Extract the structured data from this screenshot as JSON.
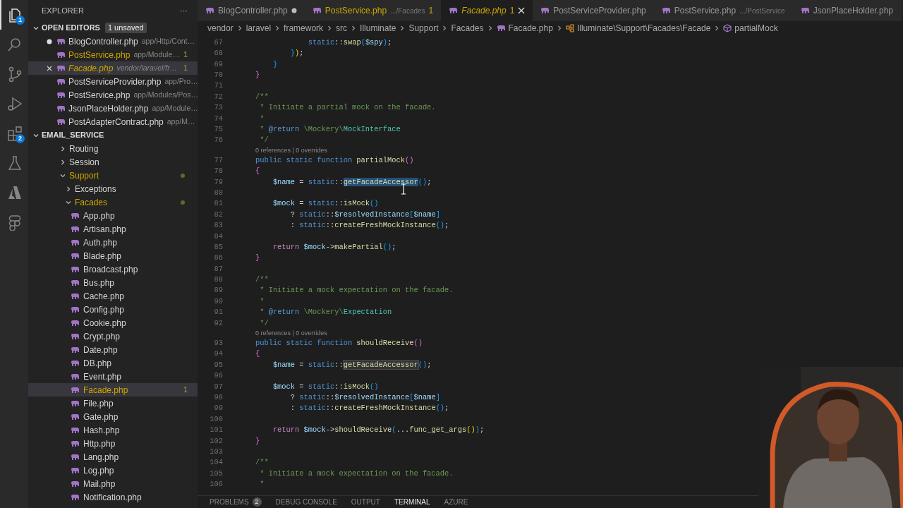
{
  "activity_bar": [
    {
      "kind": "files",
      "selected": true,
      "badge": "1"
    },
    {
      "kind": "search",
      "selected": false
    },
    {
      "kind": "source_control",
      "selected": false
    },
    {
      "kind": "run",
      "selected": false
    },
    {
      "kind": "extensions",
      "selected": false,
      "badge": "2"
    },
    {
      "kind": "testing",
      "selected": false
    },
    {
      "kind": "azure",
      "selected": false
    },
    {
      "kind": "figma",
      "selected": false
    }
  ],
  "sidebar": {
    "title": "EXPLORER",
    "more": "···",
    "open_editors": {
      "title": "OPEN EDITORS",
      "badge": "1 unsaved",
      "expanded": true,
      "items": [
        {
          "name": "BlogController.php",
          "path": "app/Http/Cont…",
          "dirty": true,
          "selected": false,
          "warning": false,
          "preview": false
        },
        {
          "name": "PostService.php",
          "path": "app/Module…",
          "count": "1",
          "dirty": false,
          "selected": false,
          "warning": true,
          "preview": false
        },
        {
          "name": "Facade.php",
          "path": "vendor/laravel/fr…",
          "count": "1",
          "dirty": false,
          "selected": true,
          "warning": true,
          "preview": true
        },
        {
          "name": "PostServiceProvider.php",
          "path": "app/Pro…",
          "dirty": false,
          "selected": false,
          "warning": false,
          "preview": false
        },
        {
          "name": "PostService.php",
          "path": "app/Modules/Pos…",
          "dirty": false,
          "selected": false,
          "warning": false,
          "preview": false
        },
        {
          "name": "JsonPlaceHolder.php",
          "path": "app/Module…",
          "dirty": false,
          "selected": false,
          "warning": false,
          "preview": false
        },
        {
          "name": "PostAdapterContract.php",
          "path": "app/M…",
          "dirty": false,
          "selected": false,
          "warning": false,
          "preview": false
        }
      ]
    },
    "project": {
      "title": "EMAIL_SERVICE",
      "expanded": true,
      "tree": [
        {
          "name": "Routing",
          "kind": "folder",
          "expanded": false,
          "selected": false,
          "warning": false
        },
        {
          "name": "Session",
          "kind": "folder",
          "expanded": false,
          "selected": false,
          "warning": false
        },
        {
          "name": "Support",
          "kind": "folder",
          "expanded": true,
          "selected": false,
          "warning": true,
          "children": [
            {
              "name": "Exceptions",
              "kind": "folder",
              "expanded": false,
              "selected": false,
              "warning": false
            },
            {
              "name": "Facades",
              "kind": "folder",
              "expanded": true,
              "selected": false,
              "warning": true,
              "children": [
                {
                  "name": "App.php",
                  "kind": "file",
                  "selected": false,
                  "warning": false
                },
                {
                  "name": "Artisan.php",
                  "kind": "file",
                  "selected": false,
                  "warning": false
                },
                {
                  "name": "Auth.php",
                  "kind": "file",
                  "selected": false,
                  "warning": false
                },
                {
                  "name": "Blade.php",
                  "kind": "file",
                  "selected": false,
                  "warning": false
                },
                {
                  "name": "Broadcast.php",
                  "kind": "file",
                  "selected": false,
                  "warning": false
                },
                {
                  "name": "Bus.php",
                  "kind": "file",
                  "selected": false,
                  "warning": false
                },
                {
                  "name": "Cache.php",
                  "kind": "file",
                  "selected": false,
                  "warning": false
                },
                {
                  "name": "Config.php",
                  "kind": "file",
                  "selected": false,
                  "warning": false
                },
                {
                  "name": "Cookie.php",
                  "kind": "file",
                  "selected": false,
                  "warning": false
                },
                {
                  "name": "Crypt.php",
                  "kind": "file",
                  "selected": false,
                  "warning": false
                },
                {
                  "name": "Date.php",
                  "kind": "file",
                  "selected": false,
                  "warning": false
                },
                {
                  "name": "DB.php",
                  "kind": "file",
                  "selected": false,
                  "warning": false
                },
                {
                  "name": "Event.php",
                  "kind": "file",
                  "selected": false,
                  "warning": false
                },
                {
                  "name": "Facade.php",
                  "kind": "file",
                  "selected": true,
                  "warning": true,
                  "count": "1"
                },
                {
                  "name": "File.php",
                  "kind": "file",
                  "selected": false,
                  "warning": false
                },
                {
                  "name": "Gate.php",
                  "kind": "file",
                  "selected": false,
                  "warning": false
                },
                {
                  "name": "Hash.php",
                  "kind": "file",
                  "selected": false,
                  "warning": false
                },
                {
                  "name": "Http.php",
                  "kind": "file",
                  "selected": false,
                  "warning": false
                },
                {
                  "name": "Lang.php",
                  "kind": "file",
                  "selected": false,
                  "warning": false
                },
                {
                  "name": "Log.php",
                  "kind": "file",
                  "selected": false,
                  "warning": false
                },
                {
                  "name": "Mail.php",
                  "kind": "file",
                  "selected": false,
                  "warning": false
                },
                {
                  "name": "Notification.php",
                  "kind": "file",
                  "selected": false,
                  "warning": false
                }
              ]
            }
          ]
        }
      ]
    }
  },
  "tabs": [
    {
      "name": "BlogController.php",
      "dirty": true,
      "selected": false,
      "warning": false,
      "preview": false
    },
    {
      "name": "PostService.php",
      "detail": ".../Facades",
      "count": "1",
      "dirty": false,
      "selected": false,
      "warning": true,
      "preview": false
    },
    {
      "name": "Facade.php",
      "count": "1",
      "dirty": false,
      "selected": true,
      "warning": true,
      "preview": true
    },
    {
      "name": "PostServiceProvider.php",
      "dirty": false,
      "selected": false,
      "warning": false,
      "preview": false
    },
    {
      "name": "PostService.php",
      "detail": ".../PostService",
      "dirty": false,
      "selected": false,
      "warning": false,
      "preview": false
    },
    {
      "name": "JsonPlaceHolder.php",
      "dirty": false,
      "selected": false,
      "warning": false,
      "preview": false
    }
  ],
  "breadcrumbs": [
    {
      "kind": "folder",
      "text": "vendor"
    },
    {
      "kind": "folder",
      "text": "laravel"
    },
    {
      "kind": "folder",
      "text": "framework"
    },
    {
      "kind": "folder",
      "text": "src"
    },
    {
      "kind": "folder",
      "text": "Illuminate"
    },
    {
      "kind": "folder",
      "text": "Support"
    },
    {
      "kind": "folder",
      "text": "Facades"
    },
    {
      "kind": "file",
      "text": "Facade.php"
    },
    {
      "kind": "class",
      "text": "Illuminate\\Support\\Facades\\Facade"
    },
    {
      "kind": "method",
      "text": "partialMock"
    }
  ],
  "code": [
    {
      "kind": "code_4",
      "number": "67",
      "tokens": [
        {
          "kind": "kw",
          "text": "static"
        },
        {
          "kind": "punct",
          "text": "::"
        },
        {
          "kind": "fn",
          "text": "swap"
        },
        {
          "kind": "b2",
          "text": "("
        },
        {
          "kind": "var",
          "text": "$spy"
        },
        {
          "kind": "b2",
          "text": ")"
        },
        {
          "kind": "punct",
          "text": ";"
        }
      ]
    },
    {
      "kind": "code_3",
      "number": "68",
      "tokens": [
        {
          "kind": "b2",
          "text": "}"
        },
        {
          "kind": "b3",
          "text": ")"
        },
        {
          "kind": "punct",
          "text": ";"
        }
      ]
    },
    {
      "kind": "code_2",
      "number": "69",
      "tokens": [
        {
          "kind": "b2",
          "text": "}"
        }
      ]
    },
    {
      "kind": "code_1",
      "number": "70",
      "tokens": [
        {
          "kind": "b1",
          "text": "}"
        }
      ]
    },
    {
      "kind": "code",
      "number": "71"
    },
    {
      "kind": "code_1",
      "number": "72",
      "tokens": [
        {
          "kind": "comment",
          "text": "/**"
        }
      ]
    },
    {
      "kind": "code_1doc",
      "number": "73",
      "tokens": [
        {
          "kind": "comment",
          "text": "* Initiate a partial mock on the facade."
        }
      ]
    },
    {
      "kind": "code_1doc",
      "number": "74",
      "tokens": [
        {
          "kind": "comment",
          "text": "*"
        }
      ]
    },
    {
      "kind": "code_1doc",
      "number": "75",
      "tokens": [
        {
          "kind": "comment",
          "text": "* "
        },
        {
          "kind": "doctag",
          "text": "@return"
        },
        {
          "kind": "comment",
          "text": " \\Mockery\\"
        },
        {
          "kind": "type",
          "text": "MockInterface"
        }
      ]
    },
    {
      "kind": "code_1doc",
      "number": "76",
      "tokens": [
        {
          "kind": "comment",
          "text": "*/"
        }
      ]
    },
    {
      "kind": "lens_1",
      "text": "0 references | 0 overrides"
    },
    {
      "kind": "code_1",
      "number": "77",
      "tokens": [
        {
          "kind": "kw",
          "text": "public static function "
        },
        {
          "kind": "fn",
          "text": "partialMock"
        },
        {
          "kind": "b1",
          "text": "()"
        }
      ]
    },
    {
      "kind": "code_1",
      "number": "78",
      "tokens": [
        {
          "kind": "b1",
          "text": "{"
        }
      ]
    },
    {
      "kind": "code_2",
      "number": "79",
      "tokens": [
        {
          "kind": "var",
          "text": "$name"
        },
        {
          "kind": "punct",
          "text": " = "
        },
        {
          "kind": "kw",
          "text": "static"
        },
        {
          "kind": "punct",
          "text": "::"
        },
        {
          "kind": "sel",
          "text": "getFacadeAccessor"
        },
        {
          "kind": "b2",
          "text": "()"
        },
        {
          "kind": "punct",
          "text": ";"
        }
      ]
    },
    {
      "kind": "code",
      "number": "80"
    },
    {
      "kind": "code_2",
      "number": "81",
      "tokens": [
        {
          "kind": "var",
          "text": "$mock"
        },
        {
          "kind": "punct",
          "text": " = "
        },
        {
          "kind": "kw",
          "text": "static"
        },
        {
          "kind": "punct",
          "text": "::"
        },
        {
          "kind": "fn",
          "text": "isMock"
        },
        {
          "kind": "b2",
          "text": "()"
        }
      ]
    },
    {
      "kind": "code_3",
      "number": "82",
      "tokens": [
        {
          "kind": "punct",
          "text": "? "
        },
        {
          "kind": "kw",
          "text": "static"
        },
        {
          "kind": "punct",
          "text": "::"
        },
        {
          "kind": "var",
          "text": "$resolvedInstance"
        },
        {
          "kind": "b2",
          "text": "["
        },
        {
          "kind": "var",
          "text": "$name"
        },
        {
          "kind": "b2",
          "text": "]"
        }
      ]
    },
    {
      "kind": "code_3",
      "number": "83",
      "tokens": [
        {
          "kind": "punct",
          "text": ": "
        },
        {
          "kind": "kw",
          "text": "static"
        },
        {
          "kind": "punct",
          "text": "::"
        },
        {
          "kind": "fn",
          "text": "createFreshMockInstance"
        },
        {
          "kind": "b2",
          "text": "()"
        },
        {
          "kind": "punct",
          "text": ";"
        }
      ]
    },
    {
      "kind": "code",
      "number": "84"
    },
    {
      "kind": "code_2",
      "number": "85",
      "tokens": [
        {
          "kind": "ctrl",
          "text": "return "
        },
        {
          "kind": "var",
          "text": "$mock"
        },
        {
          "kind": "punct",
          "text": "->"
        },
        {
          "kind": "fn",
          "text": "makePartial"
        },
        {
          "kind": "b2",
          "text": "()"
        },
        {
          "kind": "punct",
          "text": ";"
        }
      ]
    },
    {
      "kind": "code_1",
      "number": "86",
      "tokens": [
        {
          "kind": "b1",
          "text": "}"
        }
      ]
    },
    {
      "kind": "code",
      "number": "87"
    },
    {
      "kind": "code_1",
      "number": "88",
      "tokens": [
        {
          "kind": "comment",
          "text": "/**"
        }
      ]
    },
    {
      "kind": "code_1doc",
      "number": "89",
      "tokens": [
        {
          "kind": "comment",
          "text": "* Initiate a mock expectation on the facade."
        }
      ]
    },
    {
      "kind": "code_1doc",
      "number": "90",
      "tokens": [
        {
          "kind": "comment",
          "text": "*"
        }
      ]
    },
    {
      "kind": "code_1doc",
      "number": "91",
      "tokens": [
        {
          "kind": "comment",
          "text": "* "
        },
        {
          "kind": "doctag",
          "text": "@return"
        },
        {
          "kind": "comment",
          "text": " \\Mockery\\"
        },
        {
          "kind": "type",
          "text": "Expectation"
        }
      ]
    },
    {
      "kind": "code_1doc",
      "number": "92",
      "tokens": [
        {
          "kind": "comment",
          "text": "*/"
        }
      ]
    },
    {
      "kind": "lens_1",
      "text": "0 references | 0 overrides"
    },
    {
      "kind": "code_1",
      "number": "93",
      "tokens": [
        {
          "kind": "kw",
          "text": "public static function "
        },
        {
          "kind": "fn",
          "text": "shouldReceive"
        },
        {
          "kind": "b1",
          "text": "()"
        }
      ]
    },
    {
      "kind": "code_1",
      "number": "94",
      "tokens": [
        {
          "kind": "b1",
          "text": "{"
        }
      ]
    },
    {
      "kind": "code_2",
      "number": "95",
      "tokens": [
        {
          "kind": "var",
          "text": "$name"
        },
        {
          "kind": "punct",
          "text": " = "
        },
        {
          "kind": "kw",
          "text": "static"
        },
        {
          "kind": "punct",
          "text": "::"
        },
        {
          "kind": "occ",
          "text": "getFacadeAccessor"
        },
        {
          "kind": "b2",
          "text": "()"
        },
        {
          "kind": "punct",
          "text": ";"
        }
      ]
    },
    {
      "kind": "code",
      "number": "96"
    },
    {
      "kind": "code_2",
      "number": "97",
      "tokens": [
        {
          "kind": "var",
          "text": "$mock"
        },
        {
          "kind": "punct",
          "text": " = "
        },
        {
          "kind": "kw",
          "text": "static"
        },
        {
          "kind": "punct",
          "text": "::"
        },
        {
          "kind": "fn",
          "text": "isMock"
        },
        {
          "kind": "b2",
          "text": "()"
        }
      ]
    },
    {
      "kind": "code_3",
      "number": "98",
      "tokens": [
        {
          "kind": "punct",
          "text": "? "
        },
        {
          "kind": "kw",
          "text": "static"
        },
        {
          "kind": "punct",
          "text": "::"
        },
        {
          "kind": "var",
          "text": "$resolvedInstance"
        },
        {
          "kind": "b2",
          "text": "["
        },
        {
          "kind": "var",
          "text": "$name"
        },
        {
          "kind": "b2",
          "text": "]"
        }
      ]
    },
    {
      "kind": "code_3",
      "number": "99",
      "tokens": [
        {
          "kind": "punct",
          "text": ": "
        },
        {
          "kind": "kw",
          "text": "static"
        },
        {
          "kind": "punct",
          "text": "::"
        },
        {
          "kind": "fn",
          "text": "createFreshMockInstance"
        },
        {
          "kind": "b2",
          "text": "()"
        },
        {
          "kind": "punct",
          "text": ";"
        }
      ]
    },
    {
      "kind": "code",
      "number": "100"
    },
    {
      "kind": "code_2",
      "number": "101",
      "tokens": [
        {
          "kind": "ctrl",
          "text": "return "
        },
        {
          "kind": "var",
          "text": "$mock"
        },
        {
          "kind": "punct",
          "text": "->"
        },
        {
          "kind": "fn",
          "text": "shouldReceive"
        },
        {
          "kind": "b2",
          "text": "("
        },
        {
          "kind": "punct",
          "text": "..."
        },
        {
          "kind": "fn",
          "text": "func_get_args"
        },
        {
          "kind": "b3",
          "text": "()"
        },
        {
          "kind": "b2",
          "text": ")"
        },
        {
          "kind": "punct",
          "text": ";"
        }
      ]
    },
    {
      "kind": "code_1",
      "number": "102",
      "tokens": [
        {
          "kind": "b1",
          "text": "}"
        }
      ]
    },
    {
      "kind": "code",
      "number": "103"
    },
    {
      "kind": "code_1",
      "number": "104",
      "tokens": [
        {
          "kind": "comment",
          "text": "/**"
        }
      ]
    },
    {
      "kind": "code_1doc",
      "number": "105",
      "tokens": [
        {
          "kind": "comment",
          "text": "* Initiate a mock expectation on the facade."
        }
      ]
    },
    {
      "kind": "code_1doc",
      "number": "106",
      "tokens": [
        {
          "kind": "comment",
          "text": "*"
        }
      ]
    }
  ],
  "panel_tabs": [
    {
      "label": "PROBLEMS",
      "badge": "2",
      "selected": false
    },
    {
      "label": "DEBUG CONSOLE",
      "selected": false
    },
    {
      "label": "OUTPUT",
      "selected": false
    },
    {
      "label": "TERMINAL",
      "selected": true
    },
    {
      "label": "AZURE",
      "selected": false
    }
  ]
}
